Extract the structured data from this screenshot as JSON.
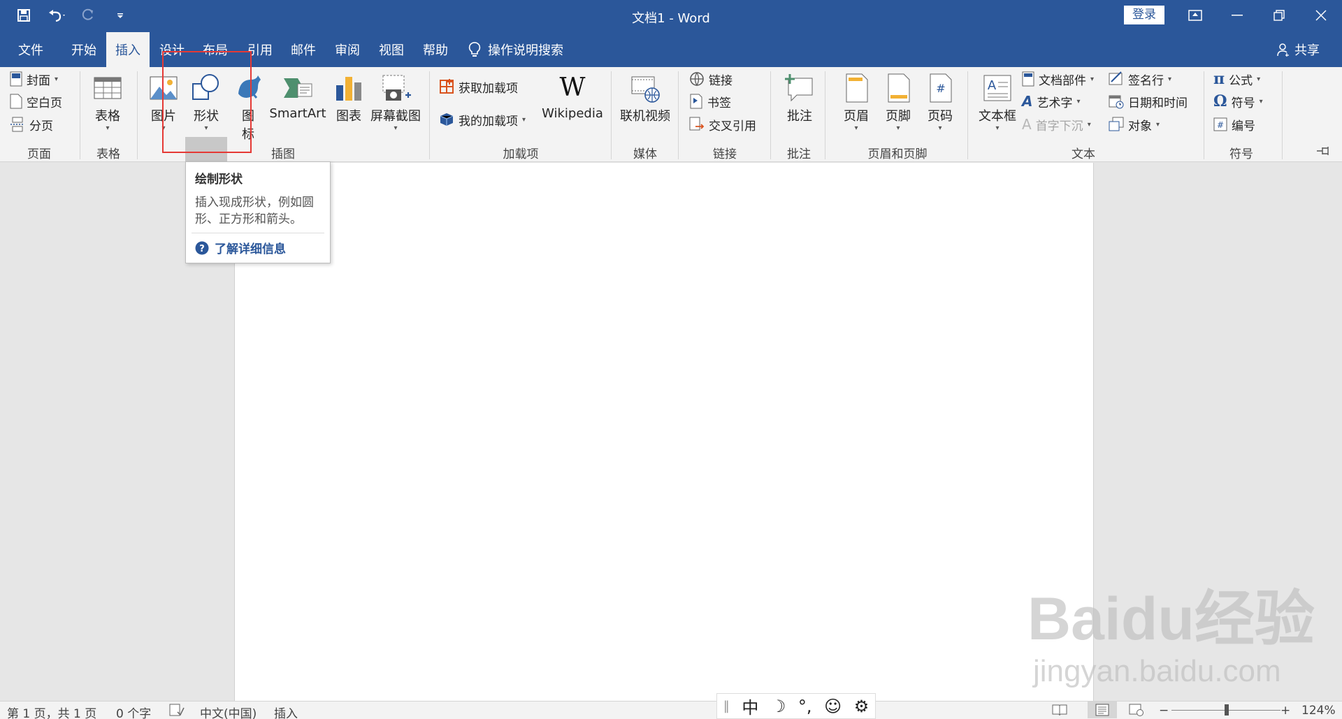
{
  "window": {
    "title": "文档1  -  Word",
    "login_label": "登录"
  },
  "tabs": [
    {
      "label": "文件"
    },
    {
      "label": "开始"
    },
    {
      "label": "插入"
    },
    {
      "label": "设计"
    },
    {
      "label": "布局"
    },
    {
      "label": "引用"
    },
    {
      "label": "邮件"
    },
    {
      "label": "审阅"
    },
    {
      "label": "视图"
    },
    {
      "label": "帮助"
    }
  ],
  "tell_me": "操作说明搜索",
  "share_label": "共享",
  "ribbon": {
    "pages": {
      "cover": "封面",
      "blank": "空白页",
      "break": "分页",
      "group": "页面"
    },
    "tables": {
      "table": "表格",
      "group": "表格"
    },
    "illustrations": {
      "picture": "图片",
      "shapes": "形状",
      "icons_1": "图",
      "icons_2": "标",
      "smartart": "SmartArt",
      "chart": "图表",
      "screenshot": "屏幕截图",
      "group": "插图"
    },
    "addins": {
      "get": "获取加载项",
      "my": "我的加载项",
      "wikipedia": "Wikipedia",
      "group": "加载项"
    },
    "media": {
      "video": "联机视频",
      "group": "媒体"
    },
    "links": {
      "link": "链接",
      "bookmark": "书签",
      "cross_ref": "交叉引用",
      "group": "链接"
    },
    "comments": {
      "comment": "批注",
      "group": "批注"
    },
    "header_footer": {
      "header": "页眉",
      "footer": "页脚",
      "page_number": "页码",
      "group": "页眉和页脚"
    },
    "text": {
      "textbox": "文本框",
      "quick_parts": "文档部件",
      "wordart": "艺术字",
      "dropcap": "首字下沉",
      "signature": "签名行",
      "datetime": "日期和时间",
      "object": "对象",
      "group": "文本"
    },
    "symbols": {
      "equation": "公式",
      "symbol": "符号",
      "number": "编号",
      "group": "符号"
    }
  },
  "tooltip": {
    "title": "绘制形状",
    "body": "插入现成形状，例如圆形、正方形和箭头。",
    "link": "了解详细信息"
  },
  "status": {
    "page": "第 1 页，共 1 页",
    "words": "0 个字",
    "language": "中文(中国)",
    "mode": "插入",
    "zoom": "124%"
  },
  "ime": {
    "lang": "中"
  },
  "watermark": {
    "main": "Baidu经验",
    "url": "jingyan.baidu.com"
  },
  "colors": {
    "accent": "#2b579a",
    "highlight": "#e53935"
  }
}
